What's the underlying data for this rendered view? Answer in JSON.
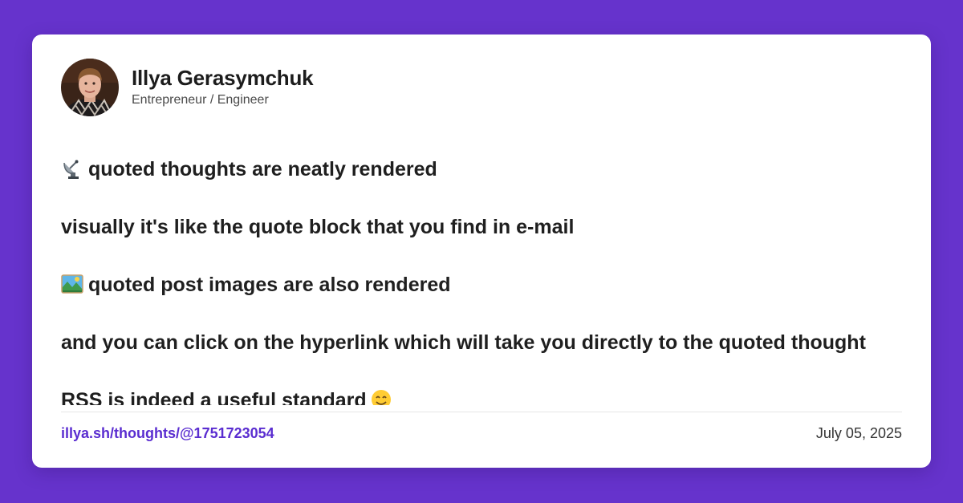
{
  "colors": {
    "background": "#6633cc",
    "card": "#ffffff",
    "link": "#5a2dd0",
    "text": "#1f1f1f"
  },
  "author": {
    "name": "Illya Gerasymchuk",
    "role": "Entrepreneur / Engineer",
    "avatar_icon": "profile-photo"
  },
  "post": {
    "paragraphs": [
      {
        "icon": "satellite-antenna-icon",
        "text": "quoted thoughts are neatly rendered"
      },
      {
        "icon": "",
        "text": "visually it's like the quote block that you find in e-mail"
      },
      {
        "icon": "picture-landscape-icon",
        "text": "quoted post images are also rendered"
      },
      {
        "icon": "",
        "text": "and you can click on the hyperlink which will take you directly to the quoted thought"
      },
      {
        "icon": "",
        "text": "RSS is indeed a useful standard",
        "trailing_icon": "smiling-face-icon"
      }
    ]
  },
  "footer": {
    "permalink": "illya.sh/thoughts/@1751723054",
    "date": "July 05, 2025"
  }
}
